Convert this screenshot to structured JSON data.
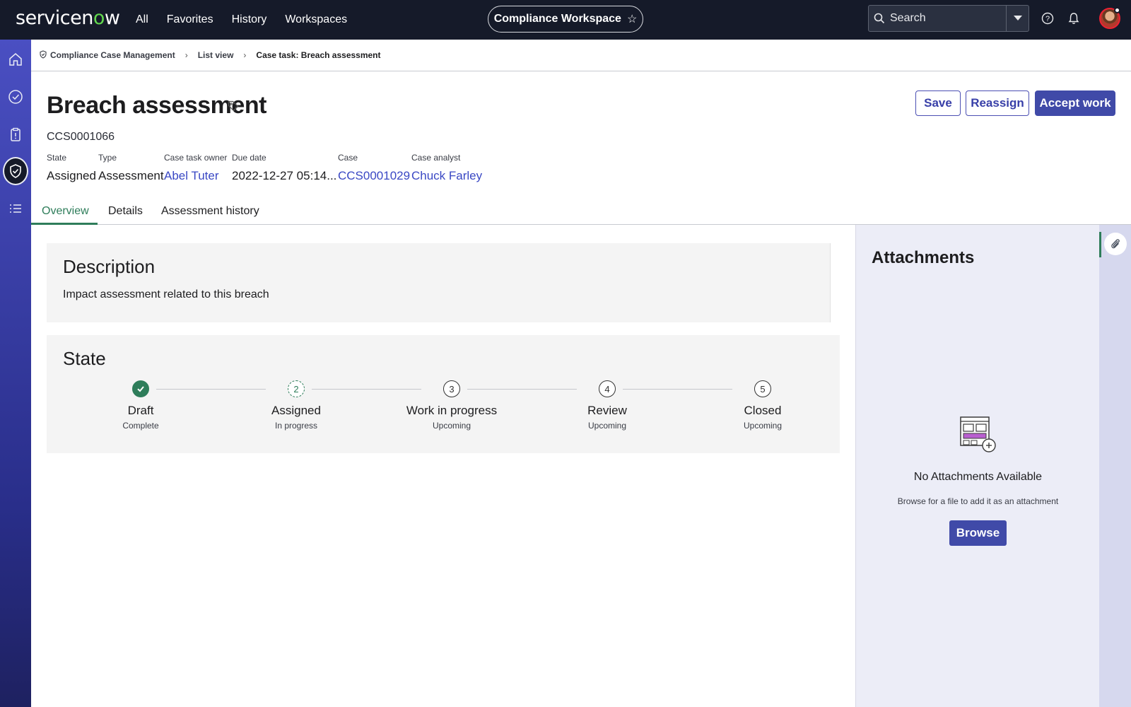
{
  "app": {
    "logo_prefix": "servicen",
    "logo_o": "o",
    "logo_suffix": "w",
    "nav": [
      "All",
      "Favorites",
      "History",
      "Workspaces"
    ],
    "workspace": "Compliance Workspace",
    "search_placeholder": "Search"
  },
  "breadcrumb": [
    "Compliance Case Management",
    "List view",
    "Case task: Breach assessment"
  ],
  "record": {
    "title": "Breach assessment",
    "number": "CCS0001066",
    "fields": [
      {
        "label": "State",
        "value": "Assigned",
        "link": false
      },
      {
        "label": "Type",
        "value": "Assessment",
        "link": false
      },
      {
        "label": "Case task owner",
        "value": "Abel Tuter",
        "link": true
      },
      {
        "label": "Due date",
        "value": "2022-12-27 05:14...",
        "link": false
      },
      {
        "label": "Case",
        "value": "CCS0001029",
        "link": true
      },
      {
        "label": "Case analyst",
        "value": "Chuck Farley",
        "link": true
      }
    ],
    "actions": {
      "save": "Save",
      "reassign": "Reassign",
      "accept": "Accept work"
    }
  },
  "tabs": [
    "Overview",
    "Details",
    "Assessment history"
  ],
  "active_tab": "Overview",
  "description": {
    "title": "Description",
    "text": "Impact assessment related to this breach"
  },
  "state": {
    "title": "State",
    "steps": [
      {
        "num": "1",
        "name": "Draft",
        "status": "Complete"
      },
      {
        "num": "2",
        "name": "Assigned",
        "status": "In progress"
      },
      {
        "num": "3",
        "name": "Work in progress",
        "status": "Upcoming"
      },
      {
        "num": "4",
        "name": "Review",
        "status": "Upcoming"
      },
      {
        "num": "5",
        "name": "Closed",
        "status": "Upcoming"
      }
    ]
  },
  "attachments": {
    "title": "Attachments",
    "empty_title": "No Attachments Available",
    "empty_hint": "Browse for a file to add it as an attachment",
    "browse": "Browse"
  },
  "colors": {
    "topbar": "#151a29",
    "accent": "#404aa8",
    "active_tab": "#2e7d5a",
    "link": "#3a48c4"
  },
  "icons": [
    "home-icon",
    "check-circle-icon",
    "clipboard-icon",
    "shield-check-icon",
    "list-icon",
    "search-icon",
    "help-icon",
    "bell-icon",
    "tag-icon",
    "paperclip-icon"
  ]
}
